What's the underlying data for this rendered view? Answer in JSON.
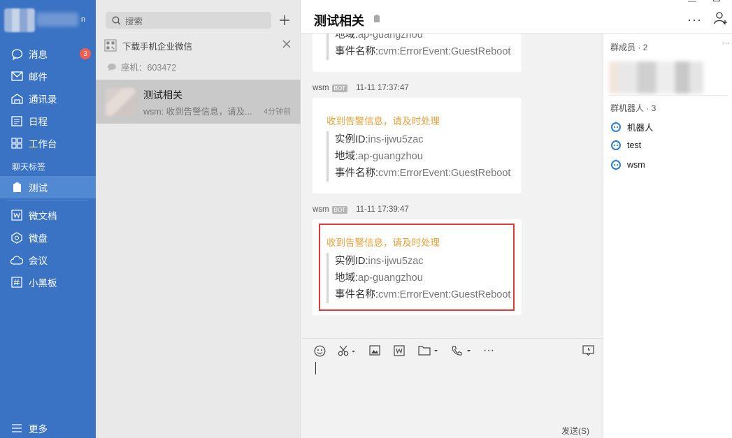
{
  "nav": {
    "profile_name_tail": "n",
    "items": [
      {
        "label": "消息",
        "badge": "3"
      },
      {
        "label": "邮件"
      },
      {
        "label": "通讯录"
      },
      {
        "label": "日程"
      },
      {
        "label": "工作台"
      }
    ],
    "tags_section_label": "聊天标签",
    "tag_item": "测试",
    "apps": [
      {
        "label": "微文档"
      },
      {
        "label": "微盘"
      },
      {
        "label": "会议"
      },
      {
        "label": "小黑板"
      }
    ],
    "more_label": "更多"
  },
  "list": {
    "search_placeholder": "搜索",
    "download_bar": "下载手机企业微信",
    "seat_text": "座机：603472",
    "conversation": {
      "title": "测试相关",
      "preview": "wsm: 收到告警信息，请及...",
      "time": "4分钟前"
    }
  },
  "chat": {
    "title": "测试相关",
    "top_card": {
      "region_label": "地域:",
      "region_value": "ap-guangzhou",
      "event_label": "事件名称:",
      "event_value": "cvm:ErrorEvent:GuestReboot"
    },
    "messages": [
      {
        "sender": "wsm",
        "bot_tag": "BOT",
        "time": "11-11 17:37:47",
        "alert": "收到告警信息，请及时处理",
        "instance_label": "实例ID:",
        "instance_value": "ins-ijwu5zac",
        "region_label": "地域:",
        "region_value": "ap-guangzhou",
        "event_label": "事件名称:",
        "event_value": "cvm:ErrorEvent:GuestReboot"
      },
      {
        "sender": "wsm",
        "bot_tag": "BOT",
        "time": "11-11 17:39:47",
        "alert": "收到告警信息，请及时处理",
        "instance_label": "实例ID:",
        "instance_value": "ins-ijwu5zac",
        "region_label": "地域:",
        "region_value": "ap-guangzhou",
        "event_label": "事件名称:",
        "event_value": "cvm:ErrorEvent:GuestReboot"
      }
    ],
    "send_label": "发送(S)"
  },
  "members": {
    "group_members_title": "群成员 · 2",
    "group_bots_title": "群机器人 · 3",
    "bots": [
      "机器人",
      "test",
      "wsm"
    ]
  },
  "colors": {
    "nav_bg": "#3a73c4",
    "alert": "#e6a23c",
    "badge": "#f35d4f",
    "highlight_border": "#e53935",
    "bot_icon": "#2f7fd6"
  }
}
